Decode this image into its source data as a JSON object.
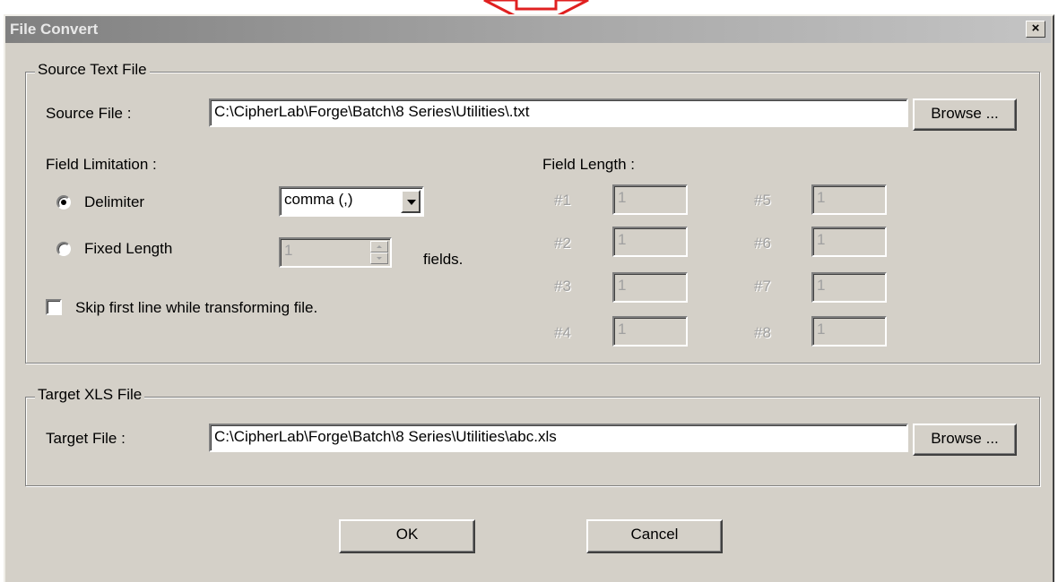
{
  "window": {
    "title": "File Convert",
    "close_glyph": "×"
  },
  "source_group": {
    "legend": "Source Text File",
    "source_file_label": "Source File :",
    "source_file_value": "C:\\CipherLab\\Forge\\Batch\\8 Series\\Utilities\\.txt",
    "browse_label": "Browse ...",
    "field_limitation_label": "Field Limitation :",
    "delimiter_label": "Delimiter",
    "delimiter_selected": true,
    "delimiter_value": "comma (,)",
    "fixed_length_label": "Fixed Length",
    "fixed_length_selected": false,
    "fields_count": "1",
    "fields_label": "fields.",
    "skip_first_line_label": "Skip first line while transforming file.",
    "skip_first_line_checked": false,
    "field_length_label": "Field Length :",
    "field_lengths": [
      {
        "label": "#1",
        "value": "1"
      },
      {
        "label": "#2",
        "value": "1"
      },
      {
        "label": "#3",
        "value": "1"
      },
      {
        "label": "#4",
        "value": "1"
      },
      {
        "label": "#5",
        "value": "1"
      },
      {
        "label": "#6",
        "value": "1"
      },
      {
        "label": "#7",
        "value": "1"
      },
      {
        "label": "#8",
        "value": "1"
      }
    ]
  },
  "target_group": {
    "legend": "Target XLS File",
    "target_file_label": "Target File :",
    "target_file_value": "C:\\CipherLab\\Forge\\Batch\\8 Series\\Utilities\\abc.xls",
    "browse_label": "Browse ..."
  },
  "buttons": {
    "ok": "OK",
    "cancel": "Cancel"
  },
  "annotation": {
    "arrow_color": "#e02020",
    "arrow_icon": "down-arrow-icon"
  }
}
